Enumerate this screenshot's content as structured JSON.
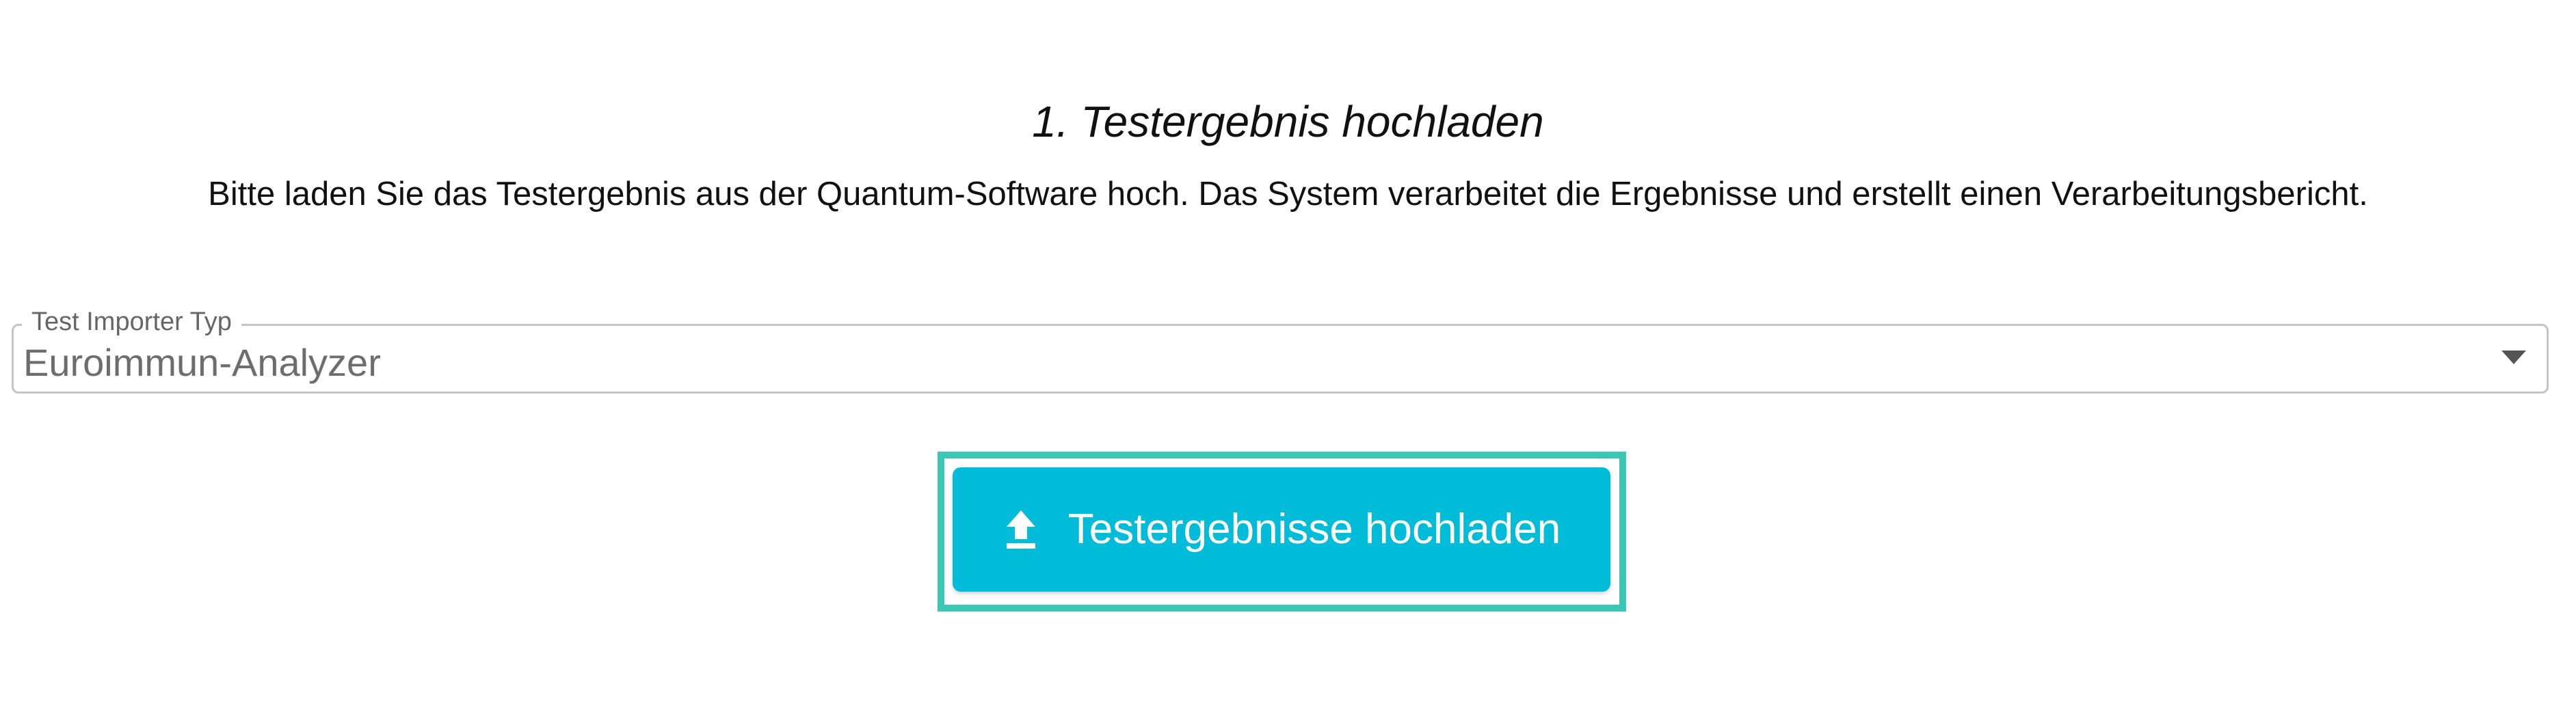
{
  "section": {
    "title": "1. Testergebnis hochladen",
    "description": "Bitte laden Sie das Testergebnis aus der Quantum-Software hoch. Das System verarbeitet die Ergebnisse und erstellt einen Verarbeitungsbericht."
  },
  "importer_select": {
    "label": "Test Importer Typ",
    "value": "Euroimmun-Analyzer",
    "icon": "chevron-down-icon"
  },
  "upload": {
    "label": "Testergebnisse hochladen",
    "icon": "upload-icon",
    "colors": {
      "button": "#00bcd8",
      "focus_frame": "#3cc7b4"
    }
  }
}
